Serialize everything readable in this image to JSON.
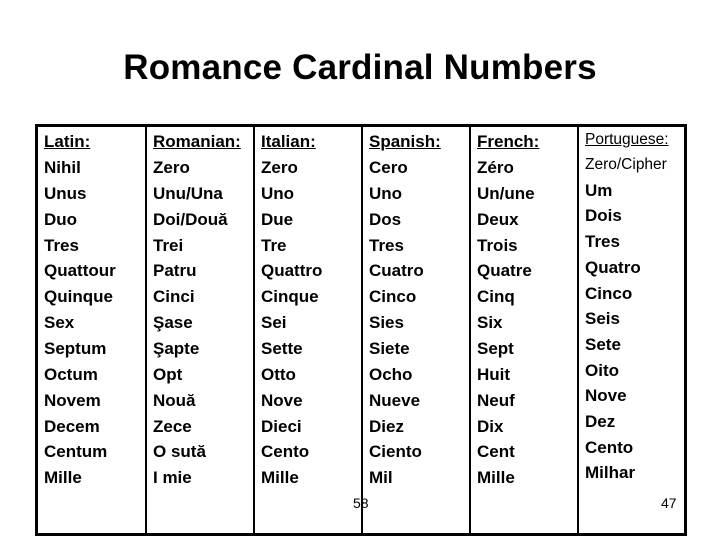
{
  "title": "Romance Cardinal Numbers",
  "columns": [
    {
      "header": "Latin:",
      "words": [
        "Nihil",
        "Unus",
        "Duo",
        "Tres",
        "Quattour",
        "Quinque",
        "Sex",
        "Septum",
        "Octum",
        "Novem",
        "Decem",
        "Centum",
        "Mille"
      ]
    },
    {
      "header": "Romanian:",
      "words": [
        "Zero",
        "Unu/Una",
        "Doi/Două",
        "Trei",
        "Patru",
        "Cinci",
        "Şase",
        "Şapte",
        "Opt",
        "Nouă",
        "Zece",
        "O sută",
        "I mie"
      ]
    },
    {
      "header": "Italian:",
      "words": [
        "Zero",
        "Uno",
        "Due",
        "Tre",
        "Quattro",
        "Cinque",
        "Sei",
        "Sette",
        "Otto",
        "Nove",
        "Dieci",
        "Cento",
        "Mille"
      ]
    },
    {
      "header": "Spanish:",
      "words": [
        "Cero",
        "Uno",
        "Dos",
        "Tres",
        "Cuatro",
        "Cinco",
        "Sies",
        "Siete",
        "Ocho",
        "Nueve",
        "Diez",
        "Ciento",
        "Mil"
      ]
    },
    {
      "header": "French:",
      "words": [
        "Zéro",
        "Un/une",
        "Deux",
        "Trois",
        "Quatre",
        "Cinq",
        "Six",
        "Sept",
        "Huit",
        "Neuf",
        "Dix",
        "Cent",
        "Mille"
      ]
    },
    {
      "header": "Portuguese:",
      "words": [
        "Zero/Cipher",
        "Um",
        "Dois",
        "Tres",
        "Quatro",
        "Cinco",
        "Seis",
        "Sete",
        "Oito",
        "Nove",
        "Dez",
        "Cento",
        "Milhar"
      ]
    }
  ],
  "page_numbers": {
    "center": "58",
    "right": "47"
  }
}
